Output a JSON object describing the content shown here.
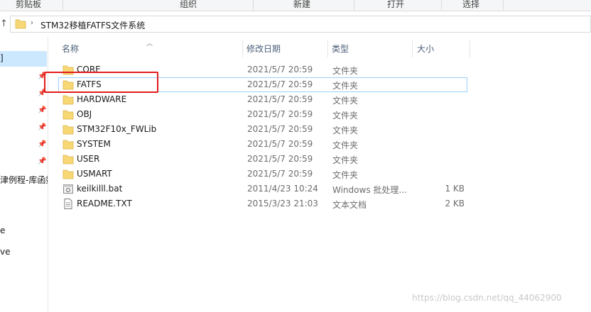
{
  "ribbon": {
    "groups": [
      "剪贴板",
      "组织",
      "新建",
      "打开",
      "选择"
    ]
  },
  "address": {
    "path": "STM32移植FATFS文件系统",
    "separator": "›"
  },
  "nav": {
    "selected_label": "]",
    "items": [
      "津例程-库函数",
      "e",
      "ve"
    ]
  },
  "columns": {
    "name": "名称",
    "date": "修改日期",
    "type": "类型",
    "size": "大小"
  },
  "files": [
    {
      "name": "CORE",
      "date": "2021/5/7 20:59",
      "type": "文件夹",
      "size": "",
      "icon": "folder-icon"
    },
    {
      "name": "FATFS",
      "date": "2021/5/7 20:59",
      "type": "文件夹",
      "size": "",
      "icon": "folder-icon"
    },
    {
      "name": "HARDWARE",
      "date": "2021/5/7 20:59",
      "type": "文件夹",
      "size": "",
      "icon": "folder-icon"
    },
    {
      "name": "OBJ",
      "date": "2021/5/7 20:59",
      "type": "文件夹",
      "size": "",
      "icon": "folder-icon"
    },
    {
      "name": "STM32F10x_FWLib",
      "date": "2021/5/7 20:59",
      "type": "文件夹",
      "size": "",
      "icon": "folder-icon"
    },
    {
      "name": "SYSTEM",
      "date": "2021/5/7 20:59",
      "type": "文件夹",
      "size": "",
      "icon": "folder-icon"
    },
    {
      "name": "USER",
      "date": "2021/5/7 20:59",
      "type": "文件夹",
      "size": "",
      "icon": "folder-icon"
    },
    {
      "name": "USMART",
      "date": "2021/5/7 20:59",
      "type": "文件夹",
      "size": "",
      "icon": "folder-icon"
    },
    {
      "name": "keilkilll.bat",
      "date": "2011/4/23 10:24",
      "type": "Windows 批处理...",
      "size": "1 KB",
      "icon": "batch-file-icon"
    },
    {
      "name": "README.TXT",
      "date": "2015/3/23 21:03",
      "type": "文本文档",
      "size": "2 KB",
      "icon": "text-file-icon"
    }
  ],
  "watermark": "https://blog.csdn.net/qq_44062900",
  "colors": {
    "folder": "#f8d775",
    "selection": "#cce8ff",
    "highlight_box": "#e31b1b",
    "header_text": "#4c607a"
  }
}
